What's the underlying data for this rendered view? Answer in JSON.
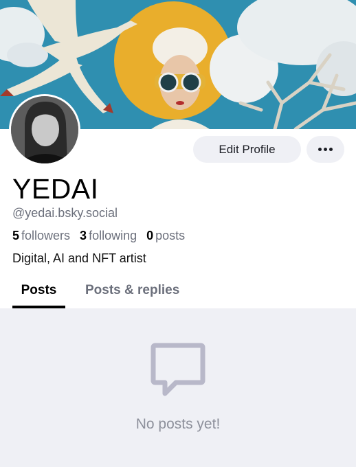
{
  "profile": {
    "display_name": "YEDAI",
    "handle": "@yedai.bsky.social",
    "bio": "Digital, AI and NFT artist",
    "stats": [
      {
        "count": "5",
        "label": "followers"
      },
      {
        "count": "3",
        "label": "following"
      },
      {
        "count": "0",
        "label": "posts"
      }
    ]
  },
  "actions": {
    "edit_label": "Edit Profile",
    "more_icon": "ellipsis-icon"
  },
  "tabs": [
    {
      "label": "Posts",
      "active": true
    },
    {
      "label": "Posts & replies",
      "active": false
    }
  ],
  "empty_state": {
    "icon": "message-bubble-icon",
    "text": "No posts yet!"
  },
  "colors": {
    "muted_text": "#6b6f7b",
    "button_bg": "#eff0f5",
    "empty_bg": "#eff0f5",
    "empty_icon": "#b8b8c9",
    "banner_sky": "#2f8fb0",
    "banner_sun": "#e9ae2c"
  }
}
